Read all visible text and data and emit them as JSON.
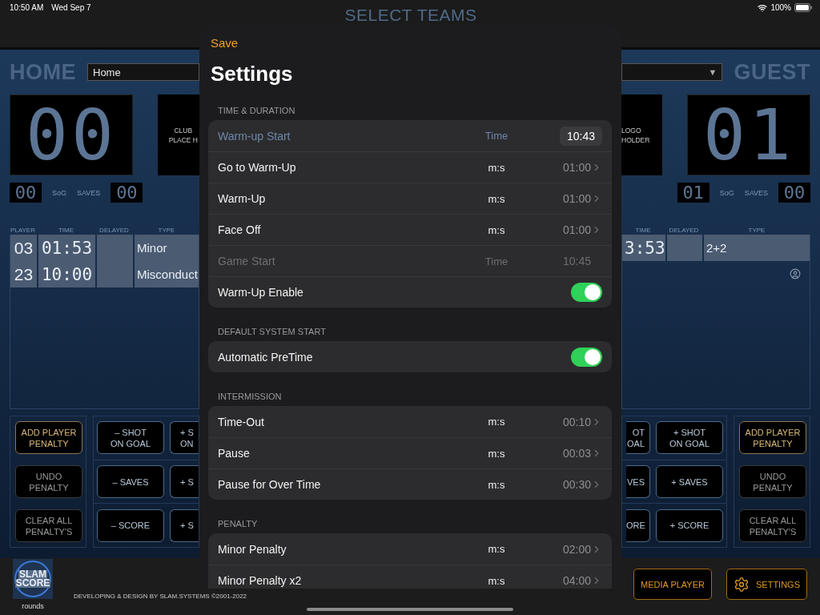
{
  "status_bar": {
    "time": "10:50 AM",
    "date": "Wed Sep 7",
    "battery": "100%"
  },
  "title": "SELECT TEAMS",
  "home": {
    "label": "HOME",
    "team_field": "Home",
    "score": "00",
    "logo_text": [
      "CLUB",
      "PLACE H"
    ],
    "sog": "00",
    "sog_label": "SoG",
    "saves_label": "SAVES",
    "saves": "00",
    "penalty_columns": [
      "PLAYER",
      "TIME",
      "DELAYED",
      "TYPE"
    ],
    "penalties": [
      {
        "player": "03",
        "time": "01:53",
        "type": "Minor"
      },
      {
        "player": "23",
        "time": "10:00",
        "type": "Misconduct"
      }
    ],
    "penalty_buttons": [
      {
        "label": "ADD PLAYER\nPENALTY",
        "highlighted": true
      },
      {
        "label": "UNDO\nPENALTY",
        "highlighted": false
      },
      {
        "label": "CLEAR ALL\nPENALTY'S",
        "highlighted": false
      }
    ],
    "stat_buttons": [
      [
        {
          "label": "– SHOT\nON GOAL",
          "cut": false
        },
        {
          "label": "+ S\nON",
          "cut": true
        }
      ],
      [
        {
          "label": "– SAVES",
          "cut": false
        },
        {
          "label": "+ S",
          "cut": true
        }
      ],
      [
        {
          "label": "– SCORE",
          "cut": false
        },
        {
          "label": "+ S",
          "cut": true
        }
      ]
    ]
  },
  "guest": {
    "label": "GUEST",
    "team_field_arrow": "▼",
    "score": "01",
    "logo_text": [
      "LOGO",
      "HOLDER"
    ],
    "sog": "01",
    "sog_label": "SoG",
    "saves_label": "SAVES",
    "saves": "00",
    "penalty_columns": [
      "TIME",
      "DELAYED",
      "TYPE"
    ],
    "penalties": [
      {
        "time": "3:53",
        "type": "2+2"
      }
    ],
    "penalty_buttons": [
      {
        "label": "ADD PLAYER\nPENALTY",
        "highlighted": true
      },
      {
        "label": "UNDO\nPENALTY",
        "highlighted": false
      },
      {
        "label": "CLEAR ALL\nPENALTY'S",
        "highlighted": false
      }
    ],
    "stat_buttons": [
      [
        {
          "label": "OT\nOAL",
          "cut": true
        },
        {
          "label": "+ SHOT\nON GOAL",
          "cut": false
        }
      ],
      [
        {
          "label": "VES",
          "cut": true
        },
        {
          "label": "+ SAVES",
          "cut": false
        }
      ],
      [
        {
          "label": "ORE",
          "cut": true
        },
        {
          "label": "+ SCORE",
          "cut": false
        }
      ]
    ]
  },
  "footer": {
    "logo": [
      "SLAM",
      "SCORE"
    ],
    "logo_caption": "rounds",
    "credits": "DEVELOPING & DESIGN BY SLAM.SYSTEMS ©2001-2022",
    "buttons": [
      {
        "label": "MEDIA PLAYER",
        "kind": "text"
      },
      {
        "label": "SETTINGS",
        "kind": "gear"
      }
    ]
  },
  "settings": {
    "save": "Save",
    "title": "Settings",
    "sections": [
      {
        "header": "TIME & DURATION",
        "rows": [
          {
            "label": "Warm-up Start",
            "kind": "picker",
            "unit": "Time",
            "value": "10:43",
            "disabled": false
          },
          {
            "label": "Go to Warm-Up",
            "kind": "duration",
            "unit": "m:s",
            "value": "01:00",
            "disabled": false
          },
          {
            "label": "Warm-Up",
            "kind": "duration",
            "unit": "m:s",
            "value": "01:00",
            "disabled": false
          },
          {
            "label": "Face Off",
            "kind": "duration",
            "unit": "m:s",
            "value": "01:00",
            "disabled": false
          },
          {
            "label": "Game Start",
            "kind": "time",
            "unit": "Time",
            "value": "10:45",
            "disabled": true
          },
          {
            "label": "Warm-Up Enable",
            "kind": "toggle",
            "on": true,
            "disabled": false
          }
        ]
      },
      {
        "header": "DEFAULT SYSTEM START",
        "rows": [
          {
            "label": "Automatic PreTime",
            "kind": "toggle",
            "on": true,
            "disabled": false
          }
        ]
      },
      {
        "header": "INTERMISSION",
        "rows": [
          {
            "label": "Time-Out",
            "kind": "duration",
            "unit": "m:s",
            "value": "00:10",
            "disabled": false
          },
          {
            "label": "Pause",
            "kind": "duration",
            "unit": "m:s",
            "value": "00:03",
            "disabled": false
          },
          {
            "label": "Pause for Over Time",
            "kind": "duration",
            "unit": "m:s",
            "value": "00:30",
            "disabled": false
          }
        ]
      },
      {
        "header": "PENALTY",
        "rows": [
          {
            "label": "Minor Penalty",
            "kind": "duration",
            "unit": "m:s",
            "value": "02:00",
            "disabled": false
          },
          {
            "label": "Minor Penalty x2",
            "kind": "duration",
            "unit": "m:s",
            "value": "04:00",
            "disabled": false
          }
        ]
      }
    ]
  }
}
